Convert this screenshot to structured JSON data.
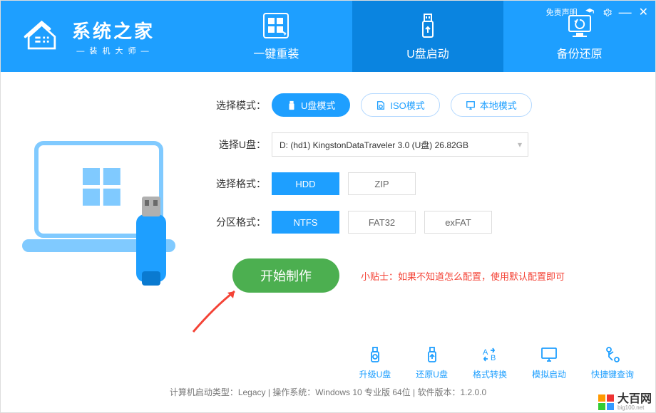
{
  "header": {
    "logo_title": "系统之家",
    "logo_subtitle": "装 机 大 师",
    "disclaimer": "免责声明"
  },
  "tabs": {
    "reinstall": "一键重装",
    "usb": "U盘启动",
    "backup": "备份还原"
  },
  "form": {
    "mode_label": "选择模式：",
    "mode_usb": "U盘模式",
    "mode_iso": "ISO模式",
    "mode_local": "本地模式",
    "drive_label": "选择U盘：",
    "drive_value": "D: (hd1) KingstonDataTraveler 3.0 (U盘) 26.82GB",
    "format_label": "选择格式：",
    "format_hdd": "HDD",
    "format_zip": "ZIP",
    "partition_label": "分区格式：",
    "part_ntfs": "NTFS",
    "part_fat32": "FAT32",
    "part_exfat": "exFAT",
    "start_button": "开始制作",
    "tip": "小贴士：如果不知道怎么配置，使用默认配置即可"
  },
  "tools": {
    "upgrade": "升级U盘",
    "restore": "还原U盘",
    "convert": "格式转换",
    "simulate": "模拟启动",
    "hotkey": "快捷键查询"
  },
  "statusbar": "计算机启动类型：Legacy | 操作系统：Windows 10 专业版 64位 | 软件版本：1.2.0.0",
  "watermark": {
    "main": "大百网",
    "sub": "big100.net"
  }
}
